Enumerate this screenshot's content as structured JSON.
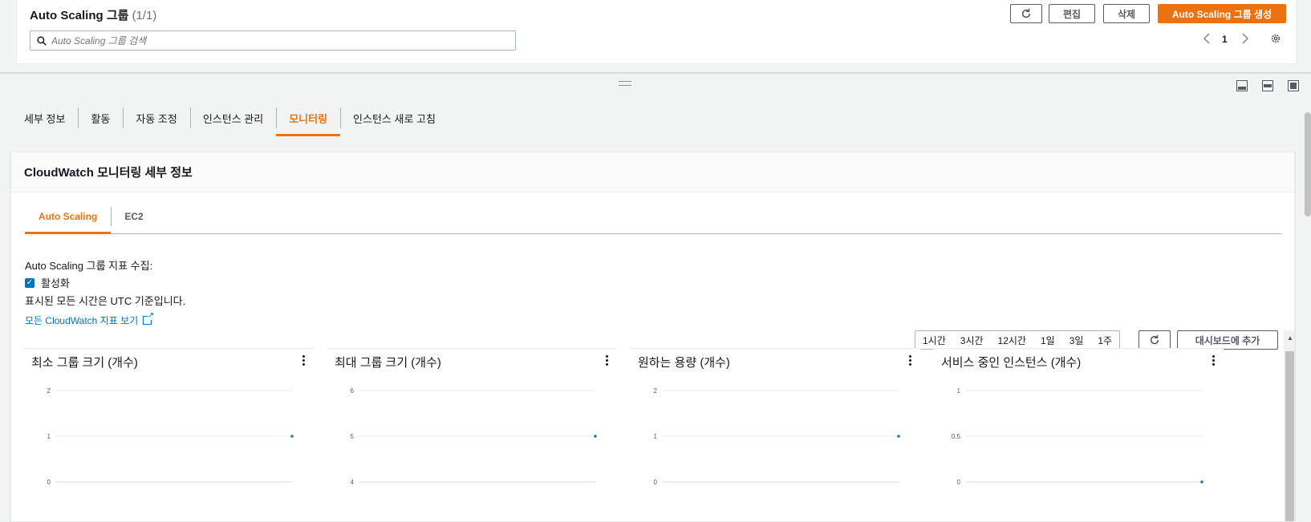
{
  "asg_table": {
    "title": "Auto Scaling 그룹",
    "count": "(1/1)",
    "edit_label": "편집",
    "delete_label": "삭제",
    "create_label": "Auto Scaling 그룹 생성",
    "search_placeholder": "Auto Scaling 그룹 검색",
    "page_number": "1"
  },
  "main_tabs": [
    {
      "label": "세부 정보"
    },
    {
      "label": "활동"
    },
    {
      "label": "자동 조정"
    },
    {
      "label": "인스턴스 관리"
    },
    {
      "label": "모니터링"
    },
    {
      "label": "인스턴스 새로 고침"
    }
  ],
  "active_main_tab": "모니터링",
  "monitoring": {
    "header": "CloudWatch 모니터링 세부 정보",
    "sub_tabs": [
      {
        "label": "Auto Scaling"
      },
      {
        "label": "EC2"
      }
    ],
    "metrics_collection_label": "Auto Scaling 그룹 지표 수집:",
    "enabled_label": "활성화",
    "utc_note": "표시된 모든 시간은 UTC 기준입니다.",
    "cloudwatch_link": "모든 CloudWatch 지표 보기",
    "time_ranges": [
      "1시간",
      "3시간",
      "12시간",
      "1일",
      "3일",
      "1주"
    ],
    "add_dashboard_label": "대시보드에 추가"
  },
  "colors": {
    "accent": "#ec7211",
    "link": "#0073bb",
    "data_point": "#1f77b4"
  },
  "chart_data": [
    {
      "type": "line",
      "title": "최소 그룹 크기 (개수)",
      "y_ticks": [
        "2",
        "1",
        "0"
      ],
      "ylim": [
        0,
        2
      ],
      "series": [
        {
          "values": [
            1
          ]
        }
      ]
    },
    {
      "type": "line",
      "title": "최대 그룹 크기 (개수)",
      "y_ticks": [
        "6",
        "5",
        "4"
      ],
      "ylim": [
        4,
        6
      ],
      "series": [
        {
          "values": [
            5
          ]
        }
      ]
    },
    {
      "type": "line",
      "title": "원하는 용량 (개수)",
      "y_ticks": [
        "2",
        "1",
        "0"
      ],
      "ylim": [
        0,
        2
      ],
      "series": [
        {
          "values": [
            1
          ]
        }
      ]
    },
    {
      "type": "line",
      "title": "서비스 중인 인스턴스 (개수)",
      "y_ticks": [
        "1",
        "0.5",
        "0"
      ],
      "ylim": [
        0,
        1
      ],
      "series": [
        {
          "values": [
            0
          ]
        }
      ]
    }
  ]
}
